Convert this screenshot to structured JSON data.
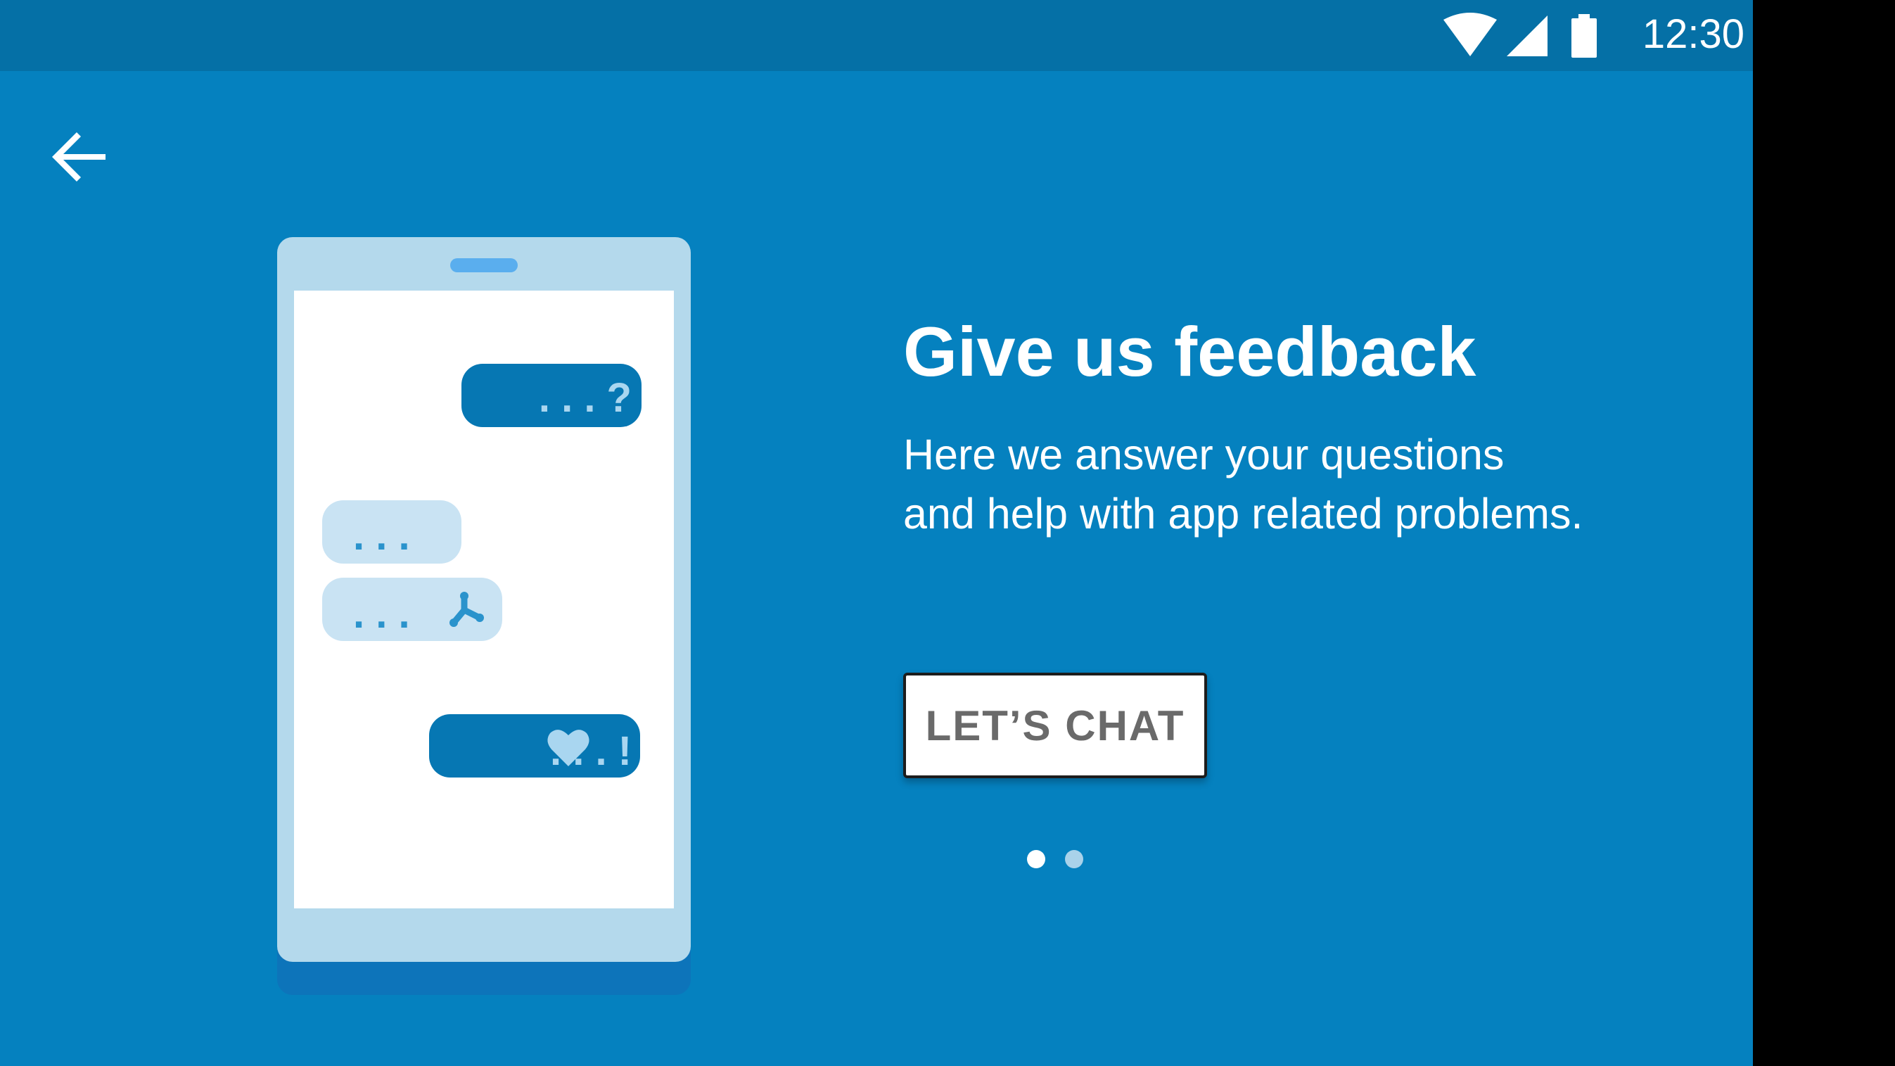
{
  "status_bar": {
    "time": "12:30",
    "icons": [
      "wifi-icon",
      "cell-signal-icon",
      "battery-icon"
    ]
  },
  "toolbar": {
    "back_icon": "arrow-left-icon"
  },
  "illustration": {
    "bubble_question": ". . . ?",
    "bubble_dots": ". . .",
    "bubble_logo": ". . .",
    "bubble_heart": ". . . !"
  },
  "content": {
    "title": "Give us feedback",
    "description_line1": "Here we answer your questions",
    "description_line2": "and help with app related problems.",
    "button_label": "LET’S CHAT"
  },
  "pager": {
    "pages": 2,
    "current": 1
  },
  "colors": {
    "background": "#0581bf",
    "status_bar": "#0570a6",
    "phone_frame": "#b4d9ec",
    "bubble_dark": "#0677b3",
    "bubble_light": "#c9e3f3",
    "button_text": "#6a6a6a"
  }
}
